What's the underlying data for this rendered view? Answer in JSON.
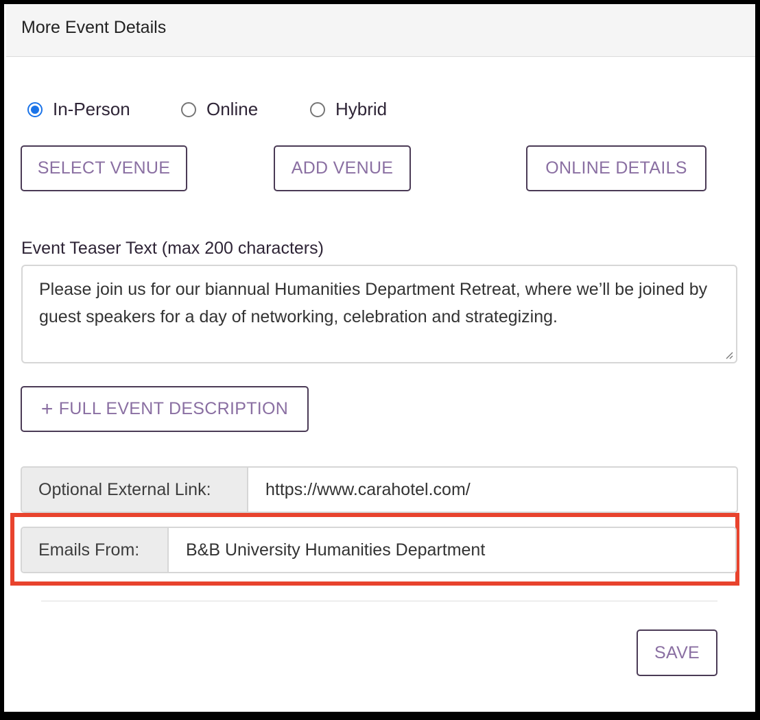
{
  "panel": {
    "title": "More Event Details"
  },
  "event_type": {
    "options": [
      {
        "label": "In-Person",
        "checked": true
      },
      {
        "label": "Online",
        "checked": false
      },
      {
        "label": "Hybrid",
        "checked": false
      }
    ]
  },
  "venue_buttons": {
    "select_venue": "SELECT VENUE",
    "add_venue": "ADD VENUE",
    "online_details": "ONLINE DETAILS"
  },
  "teaser": {
    "label": "Event Teaser Text (max 200 characters)",
    "value": "Please join us for our biannual Humanities Department Retreat, where we’ll be joined by guest speakers for a day of networking, celebration and strategizing."
  },
  "full_description_button": {
    "plus": "+",
    "label": "FULL EVENT DESCRIPTION"
  },
  "external_link": {
    "label": "Optional External Link:",
    "value": "https://www.carahotel.com/"
  },
  "emails_from": {
    "label": "Emails From:",
    "value": "B&B University Humanities Department"
  },
  "save_button": {
    "label": "SAVE"
  },
  "colors": {
    "accent_radio": "#1a73e8",
    "button_text": "#8a6fa2",
    "button_border": "#4a3a55",
    "highlight_border": "#e8432d"
  }
}
